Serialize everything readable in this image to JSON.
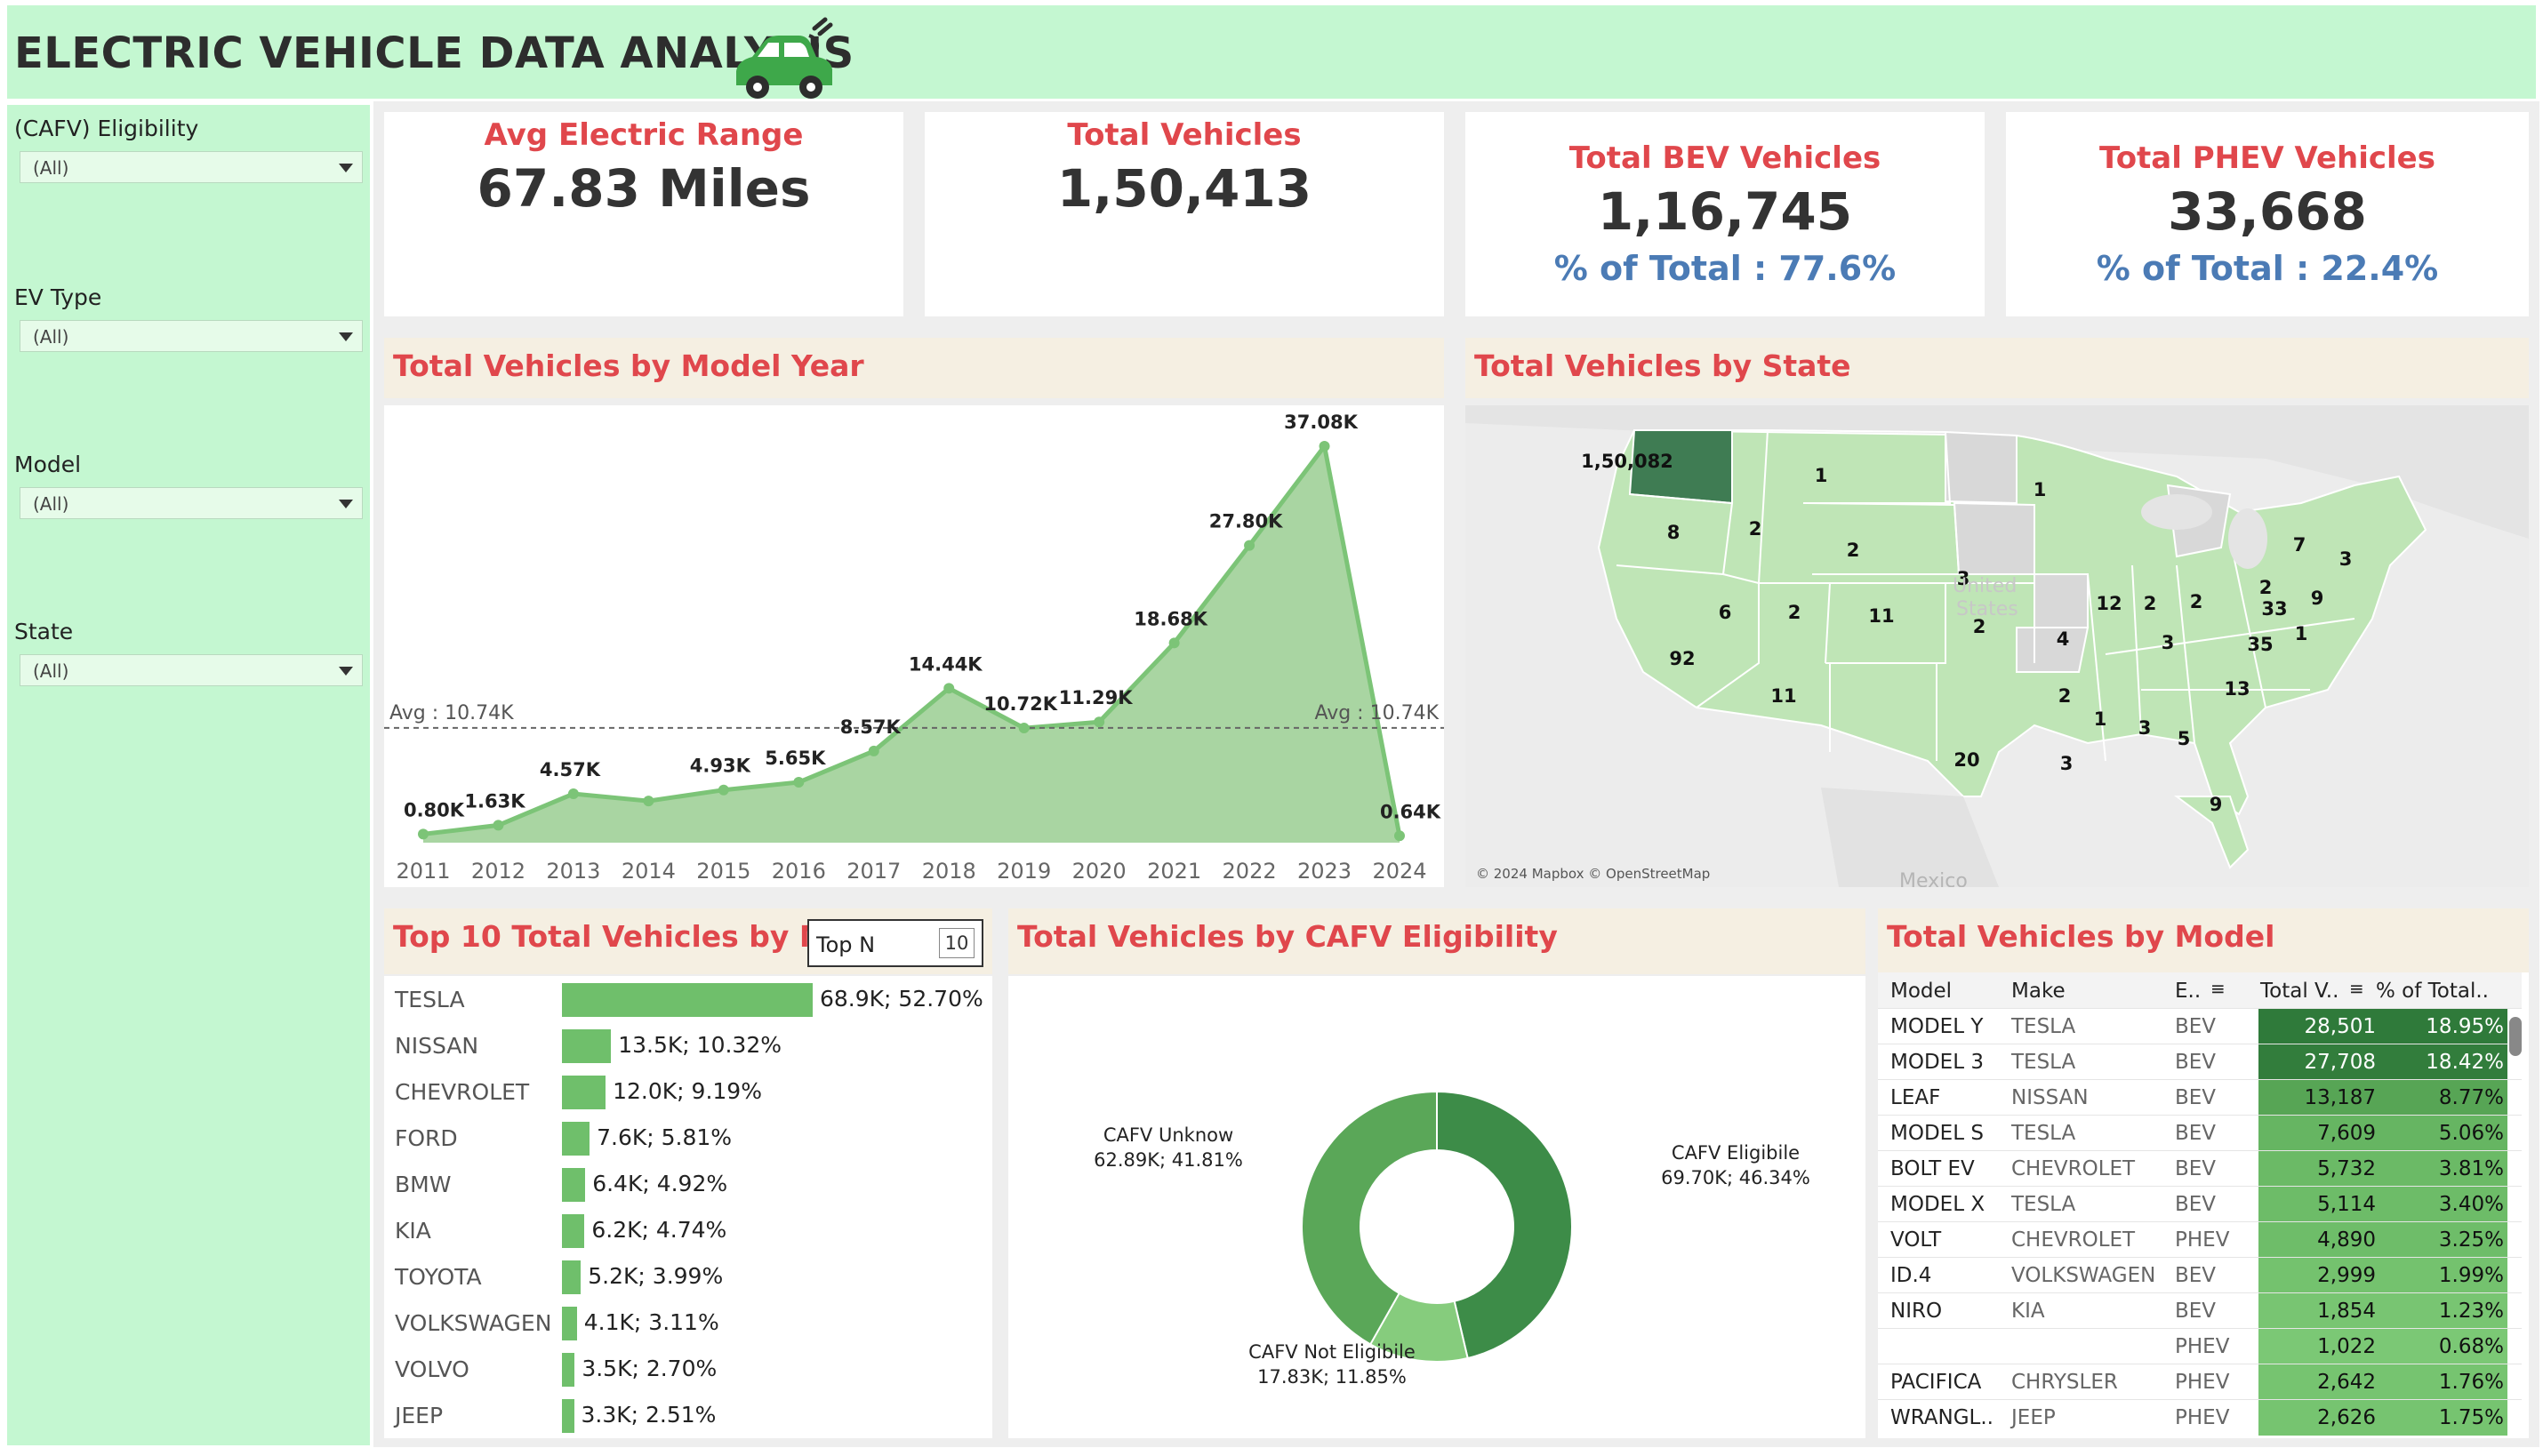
{
  "header": {
    "title": "ELECTRIC VEHICLE DATA ANALYSIS"
  },
  "filters": [
    {
      "label": "(CAFV) Eligibility",
      "value": "(All)"
    },
    {
      "label": "EV Type",
      "value": "(All)"
    },
    {
      "label": "Model",
      "value": "(All)"
    },
    {
      "label": "State",
      "value": "(All)"
    }
  ],
  "kpis": {
    "avg_range": {
      "title": "Avg Electric Range",
      "value": "67.83 Miles"
    },
    "total_vehicles": {
      "title": "Total Vehicles",
      "value": "1,50,413"
    },
    "bev": {
      "title": "Total BEV Vehicles",
      "value": "1,16,745",
      "sub": "% of Total : 77.6%"
    },
    "phev": {
      "title": "Total PHEV Vehicles",
      "value": "33,668",
      "sub": "% of Total : 22.4%"
    }
  },
  "sections": {
    "model_year": "Total Vehicles by Model Year",
    "state": "Total Vehicles by State",
    "make": "Top 10 Total Vehicles by Make",
    "cafv": "Total Vehicles by CAFV Eligibility",
    "model": "Total Vehicles by Model"
  },
  "topn": {
    "label": "Top N",
    "value": "10"
  },
  "map": {
    "credit": "© 2024 Mapbox © OpenStreetMap",
    "labels": [
      "1,50,082",
      "1",
      "1",
      "8",
      "2",
      "2",
      "3",
      "7",
      "3",
      "6",
      "2",
      "11",
      "2",
      "12",
      "2",
      "2",
      "2",
      "33",
      "9",
      "4",
      "3",
      "35",
      "1",
      "92",
      "11",
      "13",
      "2",
      "1",
      "3",
      "20",
      "5",
      "3",
      "9"
    ],
    "watermarks": [
      "United",
      "States",
      "Mexico"
    ]
  },
  "chart_data": [
    {
      "type": "area",
      "title": "Total Vehicles by Model Year",
      "x": [
        "2011",
        "2012",
        "2013",
        "2014",
        "2015",
        "2016",
        "2017",
        "2018",
        "2019",
        "2020",
        "2021",
        "2022",
        "2023",
        "2024"
      ],
      "values": [
        0.8,
        1.63,
        4.57,
        3.9,
        4.93,
        5.65,
        8.57,
        14.44,
        10.72,
        11.29,
        18.68,
        27.8,
        37.08,
        0.64
      ],
      "data_labels": [
        "0.80K",
        "1.63K",
        "4.57K",
        "",
        "4.93K",
        "5.65K",
        "8.57K",
        "14.44K",
        "10.72K",
        "11.29K",
        "18.68K",
        "27.80K",
        "37.08K",
        "0.64K"
      ],
      "unit": "K",
      "ylim": [
        0,
        37.08
      ],
      "reference_line": {
        "value": 10.74,
        "label": "Avg : 10.74K"
      },
      "grid": false,
      "colors": {
        "area": "#a9d5a2",
        "line": "#7cc477"
      }
    },
    {
      "type": "bar",
      "title": "Top 10 Total Vehicles by Make",
      "categories": [
        "TESLA",
        "NISSAN",
        "CHEVROLET",
        "FORD",
        "BMW",
        "KIA",
        "TOYOTA",
        "VOLKSWAGEN",
        "VOLVO",
        "JEEP"
      ],
      "values": [
        68.9,
        13.5,
        12.0,
        7.6,
        6.4,
        6.2,
        5.2,
        4.1,
        3.5,
        3.3
      ],
      "data_labels": [
        "68.9K;  52.70%",
        "13.5K;  10.32%",
        "12.0K;  9.19%",
        "7.6K;  5.81%",
        "6.4K;  4.92%",
        "6.2K;  4.74%",
        "5.2K;  3.99%",
        "4.1K;  3.11%",
        "3.5K;  2.70%",
        "3.3K;  2.51%"
      ],
      "orientation": "horizontal",
      "xlim": [
        0,
        68.9
      ],
      "colors": {
        "bar": "#6fbf6b"
      }
    },
    {
      "type": "pie",
      "title": "Total Vehicles by CAFV Eligibility",
      "donut": true,
      "slices": [
        {
          "label": "CAFV Eligibile",
          "value": 69.7,
          "pct": 46.34,
          "text": "69.70K; 46.34%",
          "color": "#3d8c48"
        },
        {
          "label": "CAFV Not Eligibile",
          "value": 17.83,
          "pct": 11.85,
          "text": "17.83K; 11.85%",
          "color": "#86cc7d"
        },
        {
          "label": "CAFV Unknow",
          "value": 62.89,
          "pct": 41.81,
          "text": "62.89K; 41.81%",
          "color": "#5aa758"
        }
      ]
    },
    {
      "type": "table",
      "title": "Total Vehicles by Model",
      "columns": [
        "Model",
        "Make",
        "E..",
        "Total V..",
        "% of Total.."
      ],
      "rows": [
        {
          "model": "MODEL Y",
          "make": "TESLA",
          "ev": "BEV",
          "total": "28,501",
          "pct": "18.95%",
          "color": "#2f7a3a"
        },
        {
          "model": "MODEL 3",
          "make": "TESLA",
          "ev": "BEV",
          "total": "27,708",
          "pct": "18.42%",
          "color": "#327d3c"
        },
        {
          "model": "LEAF",
          "make": "NISSAN",
          "ev": "BEV",
          "total": "13,187",
          "pct": "8.77%",
          "color": "#57a555"
        },
        {
          "model": "MODEL S",
          "make": "TESLA",
          "ev": "BEV",
          "total": "7,609",
          "pct": "5.06%",
          "color": "#66b562"
        },
        {
          "model": "BOLT EV",
          "make": "CHEVROLET",
          "ev": "BEV",
          "total": "5,732",
          "pct": "3.81%",
          "color": "#6bba66"
        },
        {
          "model": "MODEL X",
          "make": "TESLA",
          "ev": "BEV",
          "total": "5,114",
          "pct": "3.40%",
          "color": "#6dbc68"
        },
        {
          "model": "VOLT",
          "make": "CHEVROLET",
          "ev": "PHEV",
          "total": "4,890",
          "pct": "3.25%",
          "color": "#6ebd69"
        },
        {
          "model": "ID.4",
          "make": "VOLKSWAGEN",
          "ev": "BEV",
          "total": "2,999",
          "pct": "1.99%",
          "color": "#74c26e"
        },
        {
          "model": "NIRO",
          "make": "KIA",
          "ev": "BEV",
          "total": "1,854",
          "pct": "1.23%",
          "color": "#78c572"
        },
        {
          "model": "",
          "make": "",
          "ev": "PHEV",
          "total": "1,022",
          "pct": "0.68%",
          "color": "#7bc875"
        },
        {
          "model": "PACIFICA",
          "make": "CHRYSLER",
          "ev": "PHEV",
          "total": "2,642",
          "pct": "1.76%",
          "color": "#76c470"
        },
        {
          "model": "WRANGL..",
          "make": "JEEP",
          "ev": "PHEV",
          "total": "2,626",
          "pct": "1.75%",
          "color": "#76c470"
        }
      ]
    }
  ]
}
